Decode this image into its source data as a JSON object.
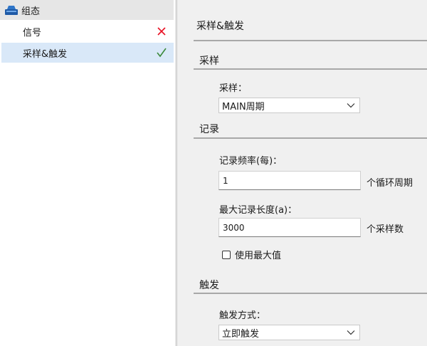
{
  "tree": {
    "root_label": "组态",
    "items": [
      {
        "label": "信号",
        "status": "error"
      },
      {
        "label": "采样&触发",
        "status": "ok"
      }
    ]
  },
  "page": {
    "title": "采样&触发",
    "sampling": {
      "title": "采样",
      "field_label": "采样：",
      "combo_value": "MAIN周期"
    },
    "recording": {
      "title": "记录",
      "rate_label": "记录频率(每)：",
      "rate_value": "1",
      "rate_unit": "个循环周期",
      "length_label": "最大记录长度(a)：",
      "length_value": "3000",
      "length_unit": "个采样数",
      "use_max_label": "使用最大值",
      "use_max_checked": false
    },
    "trigger": {
      "title": "触发",
      "mode_label": "触发方式：",
      "mode_value": "立即触发"
    }
  },
  "colors": {
    "error": "#e81123",
    "ok": "#3c8a3c",
    "selected_bg": "#d9e8f8"
  }
}
